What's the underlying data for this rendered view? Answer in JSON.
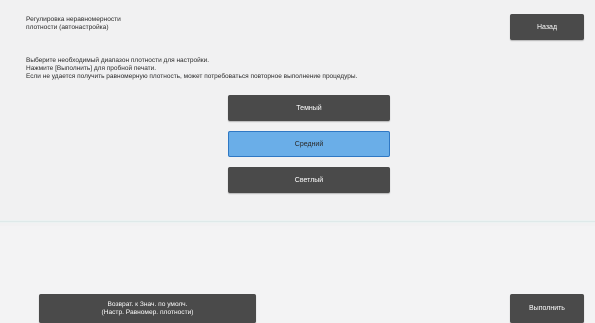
{
  "header": {
    "title_line1": "Регулировка неравномерности",
    "title_line2": "плотности (автонастройка)",
    "back_label": "Назад"
  },
  "instructions": {
    "line1": "Выберите необходимый диапазон плотности для настройки.",
    "line2": "Нажмите [Выполнить] для пробной печати.",
    "line3": "Если не удается получить равномерную плотность, может потребоваться повторное выполнение процедуры."
  },
  "options": {
    "dark": "Темный",
    "medium": "Средний",
    "light": "Светлый",
    "selected": "Средний"
  },
  "footer": {
    "reset_line1": "Возврат. к Знач. по умолч.",
    "reset_line2": "(Настр. Равномер. плотности)",
    "execute_label": "Выполнить"
  },
  "colors": {
    "button_dark": "#4a4a4a",
    "selected_fill": "#6aaee8",
    "selected_border": "#2f78c4",
    "background": "#f1f1f2"
  }
}
